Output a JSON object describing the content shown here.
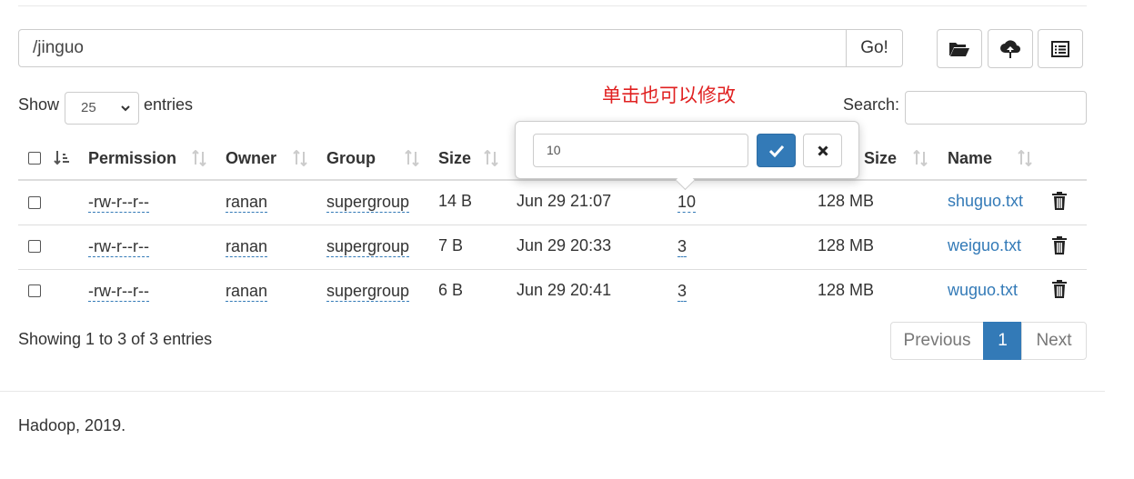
{
  "path": {
    "value": "/jinguo",
    "go_label": "Go!"
  },
  "toolbar": {
    "buttons": [
      {
        "icon": "folder-open-icon"
      },
      {
        "icon": "cloud-upload-icon"
      },
      {
        "icon": "list-alt-icon"
      }
    ]
  },
  "length": {
    "show_label": "Show",
    "selected": "25",
    "entries_label": "entries"
  },
  "annotation": "单击也可以修改",
  "search": {
    "label": "Search:",
    "value": ""
  },
  "table": {
    "headers": {
      "permission": "Permission",
      "owner": "Owner",
      "group": "Group",
      "size": "Size",
      "block_size": "t Size",
      "name": "Name"
    },
    "rows": [
      {
        "permission": "-rw-r--r--",
        "owner": "ranan",
        "group": "supergroup",
        "size": "14 B",
        "modified": "Jun 29 21:07",
        "replication": "10",
        "block_size": "128 MB",
        "name": "shuguo.txt"
      },
      {
        "permission": "-rw-r--r--",
        "owner": "ranan",
        "group": "supergroup",
        "size": "7 B",
        "modified": "Jun 29 20:33",
        "replication": "3",
        "block_size": "128 MB",
        "name": "weiguo.txt"
      },
      {
        "permission": "-rw-r--r--",
        "owner": "ranan",
        "group": "supergroup",
        "size": "6 B",
        "modified": "Jun 29 20:41",
        "replication": "3",
        "block_size": "128 MB",
        "name": "wuguo.txt"
      }
    ]
  },
  "popover": {
    "value": "10",
    "ok_icon": "check-icon",
    "cancel_icon": "close-icon"
  },
  "info": "Showing 1 to 3 of 3 entries",
  "pagination": {
    "previous": "Previous",
    "current": "1",
    "next": "Next"
  },
  "footer": "Hadoop, 2019.",
  "colors": {
    "link": "#337ab7",
    "primary": "#337ab7",
    "annotation": "#e02020"
  }
}
